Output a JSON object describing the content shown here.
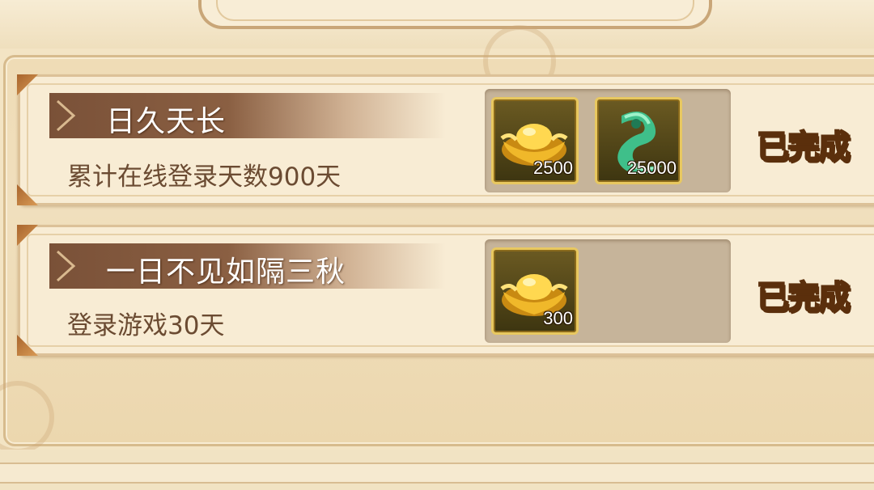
{
  "quests": [
    {
      "title": "日久天长",
      "description": "累计在线登录天数900天",
      "rewards": [
        {
          "icon": "gold-ingot-icon",
          "count": "2500"
        },
        {
          "icon": "jade-pendant-icon",
          "count": "25000"
        }
      ],
      "status": "已完成"
    },
    {
      "title": "一日不见如隔三秋",
      "description": "登录游戏30天",
      "rewards": [
        {
          "icon": "gold-ingot-icon",
          "count": "300"
        }
      ],
      "status": "已完成"
    }
  ],
  "colors": {
    "title_band": "#7a5138",
    "description_text": "#6b4b32",
    "status_text": "#f6c341",
    "item_border": "#e8c860",
    "panel_bg": "#efdcb6"
  }
}
